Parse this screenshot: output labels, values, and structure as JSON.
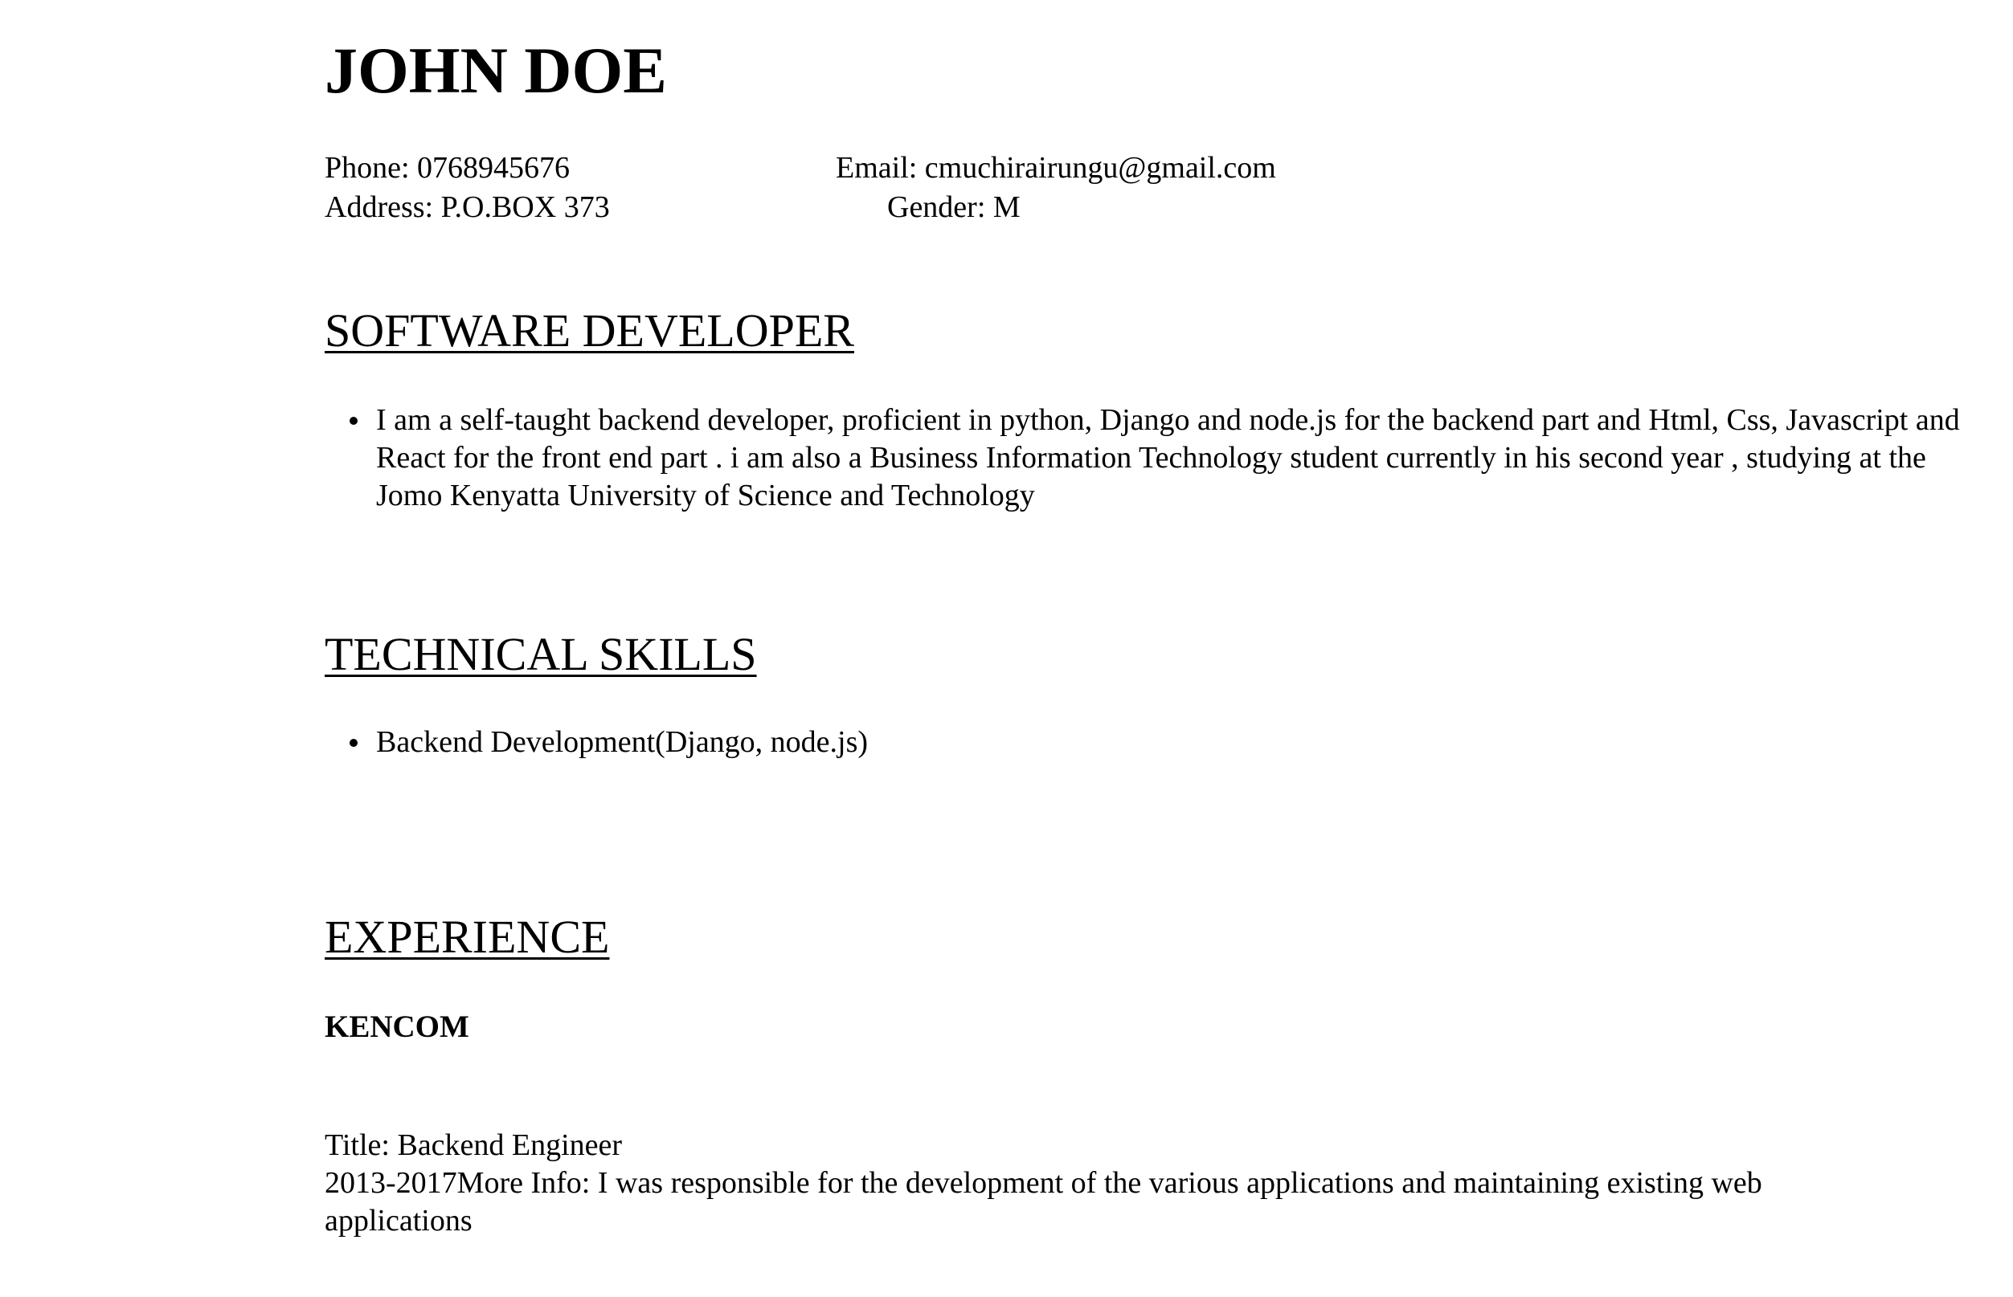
{
  "header": {
    "name": "JOHN DOE",
    "phone": "Phone: 0768945676",
    "email": "Email: cmuchirairungu@gmail.com",
    "address": "Address: P.O.BOX 373",
    "gender": "Gender: M"
  },
  "profile": {
    "title": "SOFTWARE DEVELOPER",
    "bullets": [
      "I am a self-taught backend developer, proficient in python, Django and node.js for the backend part and Html, Css, Javascript and React for the front end part . i am also a Business Information Technology student currently in his second year , studying at the Jomo Kenyatta University of Science and Technology"
    ]
  },
  "skills": {
    "title": "TECHNICAL SKILLS",
    "items": [
      "Backend Development(Django, node.js)"
    ]
  },
  "experience": {
    "title": "EXPERIENCE",
    "jobs": [
      {
        "company": "KENCOM",
        "title_line": "Title: Backend Engineer",
        "details_line": "2013-2017More Info: I was responsible for the development of the various applications and maintaining existing web applications"
      }
    ]
  }
}
